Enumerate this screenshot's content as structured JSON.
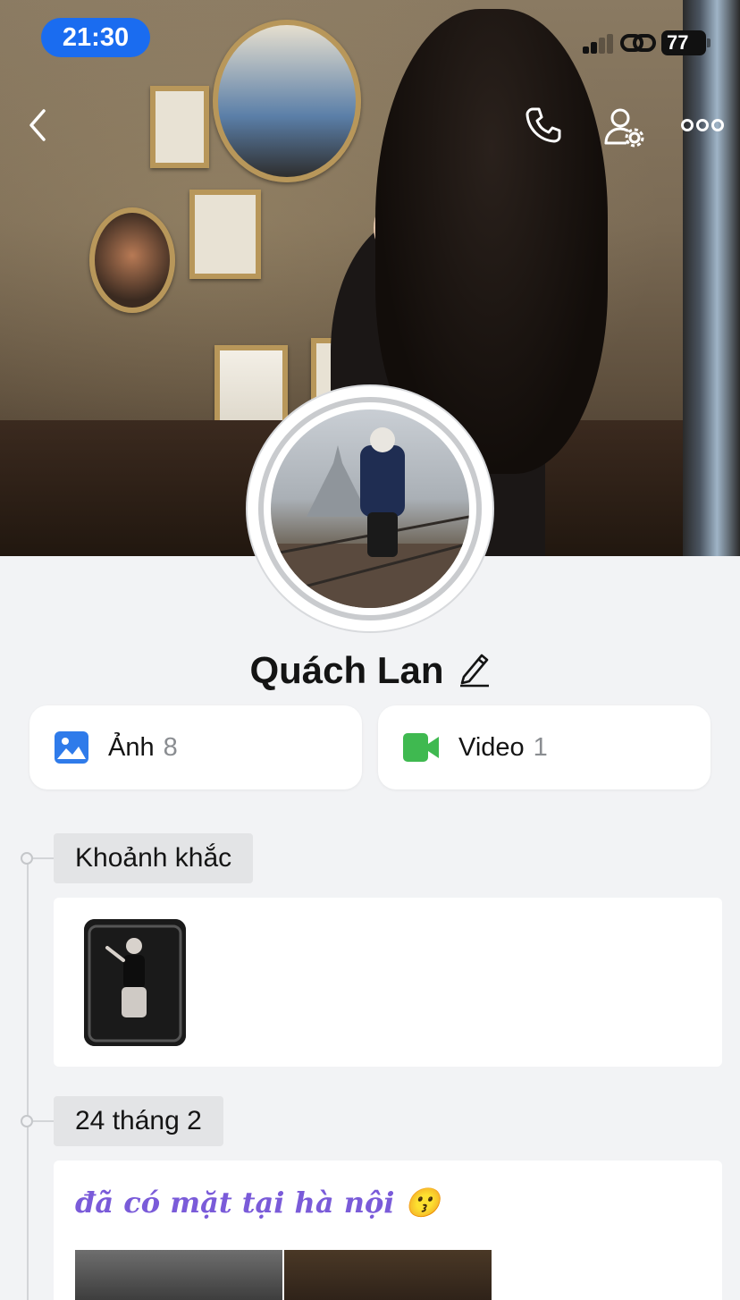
{
  "status_bar": {
    "time": "21:30",
    "battery": "77"
  },
  "profile": {
    "name": "Quách Lan"
  },
  "media": {
    "photos": {
      "label": "Ảnh",
      "count": "8"
    },
    "videos": {
      "label": "Video",
      "count": "1"
    }
  },
  "timeline": {
    "moments_label": "Khoảnh khắc",
    "date_label": "24 tháng 2",
    "post_caption": "đã có mặt tại hà nội 😗"
  },
  "colors": {
    "accent_blue": "#1a6cf0",
    "video_green": "#3fb950",
    "photo_blue": "#2f7bea",
    "caption_purple": "#7a5bd9",
    "background": "#f2f3f5"
  }
}
